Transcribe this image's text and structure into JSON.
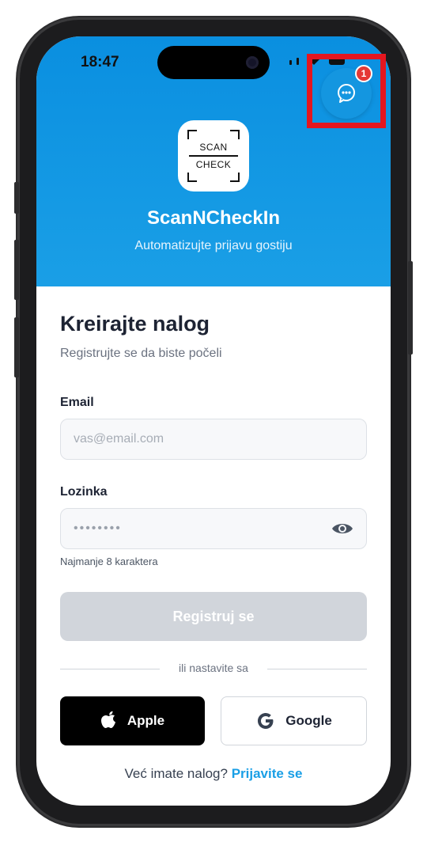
{
  "status_bar": {
    "time": "18:47"
  },
  "chat": {
    "badge_count": "1"
  },
  "logo": {
    "line1": "SCAN",
    "line2": "CHECK"
  },
  "header": {
    "app_name": "ScanNCheckIn",
    "tagline": "Automatizujte prijavu gostiju"
  },
  "form": {
    "title": "Kreirajte nalog",
    "subtitle": "Registrujte se da biste počeli",
    "email_label": "Email",
    "email_placeholder": "vas@email.com",
    "password_label": "Lozinka",
    "password_value": "••••••••",
    "password_hint": "Najmanje 8 karaktera",
    "register_label": "Registruj se"
  },
  "divider": {
    "text": "ili nastavite sa"
  },
  "social": {
    "apple_label": "Apple",
    "google_label": "Google"
  },
  "footer": {
    "prompt": "Već imate nalog?",
    "login_link": "Prijavite se"
  },
  "colors": {
    "primary": "#1a9fe6",
    "highlight": "#e4161f",
    "badge": "#e53935",
    "disabled": "#d1d5db"
  }
}
